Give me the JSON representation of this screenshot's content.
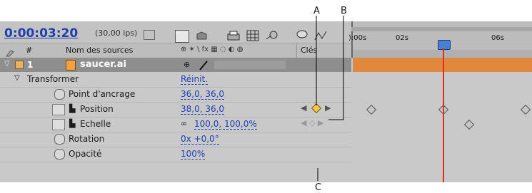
{
  "callouts": {
    "a": "A",
    "b": "B",
    "c": "C"
  },
  "header": {
    "timecode": "0:00:03:20",
    "fps": "(30,00 ips)"
  },
  "columns": {
    "num": "#",
    "source_name": "Nom des sources",
    "switches": "⊕ ✴ \\ fx ▦ ◌ ◐ ◍",
    "keys": "Clés"
  },
  "timeline": {
    "ticks": [
      "):00s",
      "02s",
      "",
      "06s"
    ],
    "layer_bar_color": "#e0883c",
    "cti_color": "#e62b1e"
  },
  "layer": {
    "number": "1",
    "name": "saucer.ai"
  },
  "transform": {
    "label": "Transformer",
    "reset": "Réinit."
  },
  "properties": [
    {
      "label": "Point d'ancrage",
      "value": "36,0, 36,0"
    },
    {
      "label": "Position",
      "value": "38,0, 36,0"
    },
    {
      "label": "Echelle",
      "value": "100,0, 100,0%"
    },
    {
      "label": "Rotation",
      "value": "0x +0,0°"
    },
    {
      "label": "Opacité",
      "value": "100%"
    }
  ]
}
